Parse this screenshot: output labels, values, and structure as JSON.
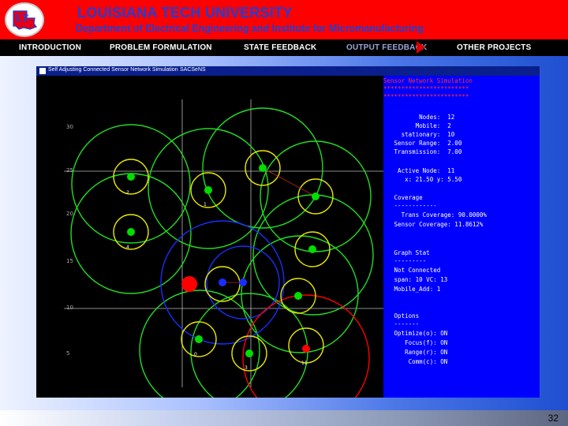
{
  "header": {
    "university": "LOUISIANA TECH UNIVERSITY",
    "department": "Department of Electrical Engineering and Institute for Micromanufacturing",
    "logo_letters": "LT"
  },
  "nav": {
    "items": [
      "INTRODUCTION",
      "PROBLEM FORMULATION",
      "STATE FEEDBACK",
      "OUTPUT FEEDBACK",
      "OTHER PROJECTS"
    ],
    "active_index": 3
  },
  "window": {
    "title": "Self Adjusting Connected Sensor Network Simulation",
    "subtitle": "SACSeNS"
  },
  "plot": {
    "y_ticks": [
      "30",
      "25",
      "20",
      "15",
      "10",
      "5"
    ],
    "node_labels": [
      "2",
      "1",
      "4",
      "0",
      "3",
      "11"
    ],
    "sensor_colors": {
      "green": "#00dd00",
      "red": "#ff0000",
      "blue": "#1a2dff",
      "circle_yellow": "#e6e600",
      "circle_green": "#22dd22"
    }
  },
  "panel": {
    "header": "Sensor Network Simulation",
    "stars1": "************************",
    "stars2": "************************",
    "stats": [
      "          Nodes:  12",
      "         Mobile:  2",
      "     stationary:  10",
      "   Sensor Range:  2.00",
      "   Transmission:  7.00"
    ],
    "active": [
      "    Active Node:  11",
      "      x: 21.50 y: 5.50"
    ],
    "coverage": [
      "   Coverage",
      "   ------------",
      "     Trans Coverage: 90.0000%",
      "   Sensor Coverage: 11.8612%"
    ],
    "graph": [
      "   Graph Stat",
      "   ---------",
      "   Not Connected",
      "   span: 10 VC: 13",
      "   Mobile_Add: 1"
    ],
    "options": [
      "   Options",
      "   -------",
      "   Optimize(o): ON",
      "      Focus(f): ON",
      "      Range(r): ON",
      "       Comm(c): ON"
    ]
  },
  "footer": {
    "page": "32"
  }
}
